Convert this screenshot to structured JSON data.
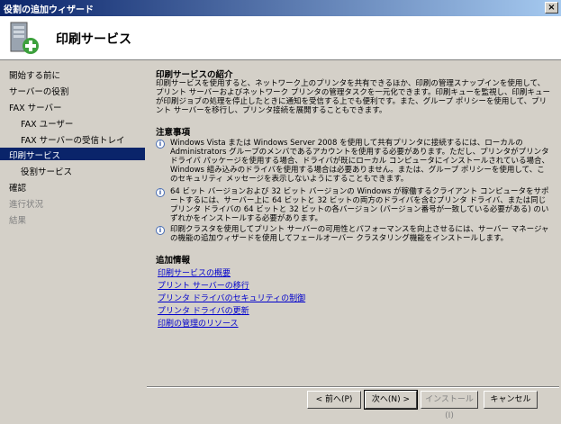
{
  "window": {
    "title": "役割の追加ウィザード",
    "close_glyph": "×"
  },
  "header": {
    "title": "印刷サービス",
    "icon": "server-add-icon"
  },
  "sidebar": {
    "items": [
      {
        "label": "開始する前に"
      },
      {
        "label": "サーバーの役割"
      },
      {
        "label": "FAX サーバー"
      },
      {
        "label": "FAX ユーザー"
      },
      {
        "label": "FAX サーバーの受信トレイ"
      },
      {
        "label": "印刷サービス"
      },
      {
        "label": "役割サービス"
      },
      {
        "label": "確認"
      },
      {
        "label": "進行状況"
      },
      {
        "label": "結果"
      }
    ]
  },
  "main": {
    "intro_heading": "印刷サービスの紹介",
    "intro_text": "印刷サービスを使用すると、ネットワーク上のプリンタを共有できるほか、印刷の管理スナップインを使用して、プリント サーバーおよびネットワーク プリンタの管理タスクを一元化できます。印刷キューを監視し、印刷キューが印刷ジョブの処理を停止したときに通知を受信する上でも便利です。また、グループ ポリシーを使用して、プリント サーバーを移行し、プリンタ接続を展開することもできます。",
    "notes_heading": "注意事項",
    "notes": [
      {
        "text": "Windows Vista または Windows Server 2008 を使用して共有プリンタに接続するには、ローカルの Administrators グループのメンバであるアカウントを使用する必要があります。ただし、プリンタがプリンタ ドライバ パッケージを使用する場合、ドライバが既にローカル コンピュータにインストールされている場合、Windows 組み込みのドライバを使用する場合は必要ありません。または、グループ ポリシーを使用して、このセキュリティ メッセージを表示しないようにすることもできます。"
      },
      {
        "text": "64 ビット バージョンおよび 32 ビット バージョンの Windows が稼働するクライアント コンピュータをサポートするには、サーバー上に 64 ビットと 32 ビットの両方のドライバを含むプリンタ ドライバ、または同じプリンタ ドライバの 64 ビットと 32 ビットの各バージョン (バージョン番号が一致している必要がある) のいずれかをインストールする必要があります。"
      },
      {
        "text": "印刷クラスタを使用してプリント サーバーの可用性とパフォーマンスを向上させるには、サーバー マネージャの機能の追加ウィザードを使用してフェールオーバー クラスタリング機能をインストールします。"
      }
    ],
    "info_heading": "追加情報",
    "links": [
      {
        "label": "印刷サービスの概要"
      },
      {
        "label": "プリント サーバーの移行"
      },
      {
        "label": "プリンタ ドライバのセキュリティの制御"
      },
      {
        "label": "プリンタ ドライバの更新"
      },
      {
        "label": "印刷の管理のリソース"
      }
    ]
  },
  "buttons": {
    "back": "< 前へ(P)",
    "next": "次へ(N) >",
    "install": "インストール(I)",
    "cancel": "キャンセル"
  }
}
